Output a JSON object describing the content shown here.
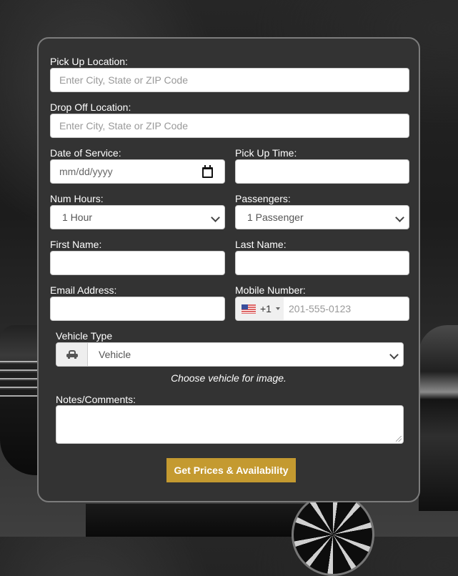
{
  "form": {
    "pickup_location": {
      "label": "Pick Up Location:",
      "placeholder": "Enter City, State or ZIP Code",
      "value": ""
    },
    "dropoff_location": {
      "label": "Drop Off Location:",
      "placeholder": "Enter City, State or ZIP Code",
      "value": ""
    },
    "date_of_service": {
      "label": "Date of Service:",
      "placeholder": "mm/dd/yyyy",
      "icon": "calendar-icon"
    },
    "pickup_time": {
      "label": "Pick Up Time:",
      "value": ""
    },
    "num_hours": {
      "label": "Num Hours:",
      "selected": "1 Hour"
    },
    "passengers": {
      "label": "Passengers:",
      "selected": "1 Passenger"
    },
    "first_name": {
      "label": "First Name:",
      "value": ""
    },
    "last_name": {
      "label": "Last Name:",
      "value": ""
    },
    "email": {
      "label": "Email Address:",
      "value": ""
    },
    "mobile": {
      "label": "Mobile Number:",
      "country_flag": "us-flag-icon",
      "dial_code": "+1",
      "placeholder": "201-555-0123"
    },
    "vehicle_type": {
      "label": "Vehicle Type",
      "icon": "car-icon",
      "selected": "Vehicle",
      "hint": "Choose vehicle for image."
    },
    "notes": {
      "label": "Notes/Comments:",
      "value": ""
    },
    "submit_label": "Get Prices & Availability"
  },
  "colors": {
    "panel_bg": "#333333",
    "panel_border": "#7c7c7c",
    "button_accent": "#c49a30",
    "label_text": "#ffffff"
  }
}
